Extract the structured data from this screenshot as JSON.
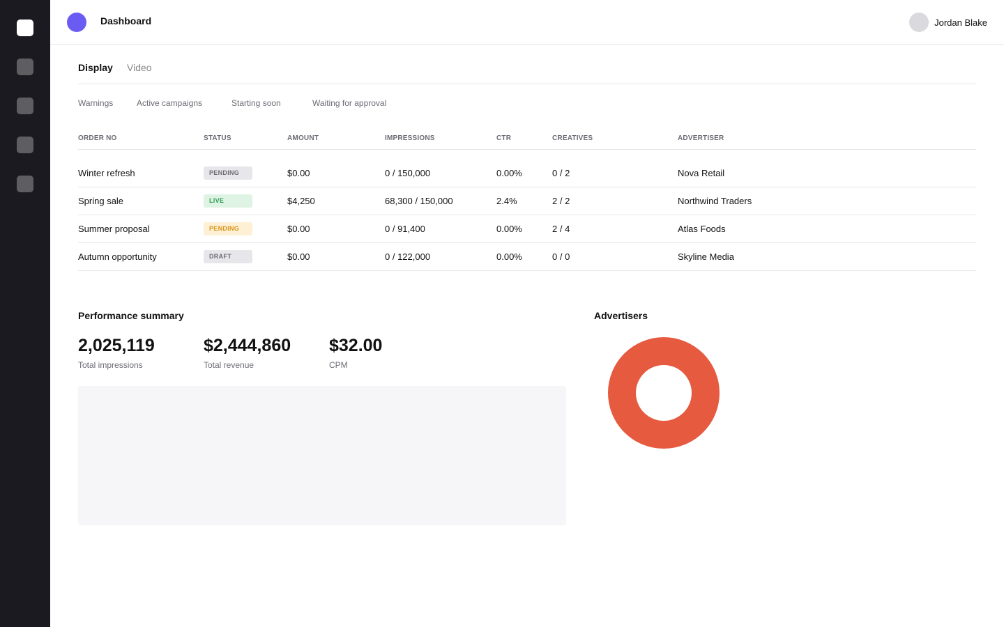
{
  "header": {
    "title": "Dashboard",
    "user_name": "Jordan Blake",
    "logo_color": "#6a5cf2"
  },
  "sidebar": {
    "items": [
      {
        "icon": "home-icon",
        "active": true
      },
      {
        "icon": "nav-icon",
        "active": false
      },
      {
        "icon": "nav-icon",
        "active": false
      },
      {
        "icon": "nav-icon",
        "active": false
      },
      {
        "icon": "nav-icon",
        "active": false
      }
    ]
  },
  "tabs": [
    {
      "label": "Display",
      "active": true
    },
    {
      "label": "Video",
      "active": false
    }
  ],
  "filters": [
    "Warnings",
    "Active campaigns",
    "Starting soon",
    "Waiting for approval"
  ],
  "table": {
    "columns": [
      "ORDER NO",
      "STATUS",
      "AMOUNT",
      "IMPRESSIONS",
      "CTR",
      "CREATIVES",
      "ADVERTISER"
    ],
    "rows": [
      {
        "order": "Winter refresh",
        "status": "PENDING",
        "status_color": "gray",
        "amount": "$0.00",
        "impressions": "0 / 150,000",
        "ctr": "0.00%",
        "creatives": "0 / 2",
        "advertiser": "Nova Retail"
      },
      {
        "order": "Spring sale",
        "status": "LIVE",
        "status_color": "green",
        "amount": "$4,250",
        "impressions": "68,300 / 150,000",
        "ctr": "2.4%",
        "creatives": "2 / 2",
        "advertiser": "Northwind Traders"
      },
      {
        "order": "Summer proposal",
        "status": "PENDING",
        "status_color": "yellow",
        "amount": "$0.00",
        "impressions": "0 / 91,400",
        "ctr": "0.00%",
        "creatives": "2 / 4",
        "advertiser": "Atlas Foods"
      },
      {
        "order": "Autumn opportunity",
        "status": "DRAFT",
        "status_color": "gray",
        "amount": "$0.00",
        "impressions": "0 / 122,000",
        "ctr": "0.00%",
        "creatives": "0 / 0",
        "advertiser": "Skyline Media"
      }
    ]
  },
  "performance": {
    "title": "Performance summary",
    "kpis": [
      {
        "value": "2,025,119",
        "label": "Total impressions"
      },
      {
        "value": "$2,444,860",
        "label": "Total revenue"
      },
      {
        "value": "$32.00",
        "label": "CPM"
      }
    ]
  },
  "advertisers": {
    "title": "Advertisers"
  },
  "chart_data": {
    "type": "pie",
    "title": "Advertisers",
    "values": [
      1
    ],
    "colors": [
      "#e65a40"
    ],
    "donut": true
  }
}
